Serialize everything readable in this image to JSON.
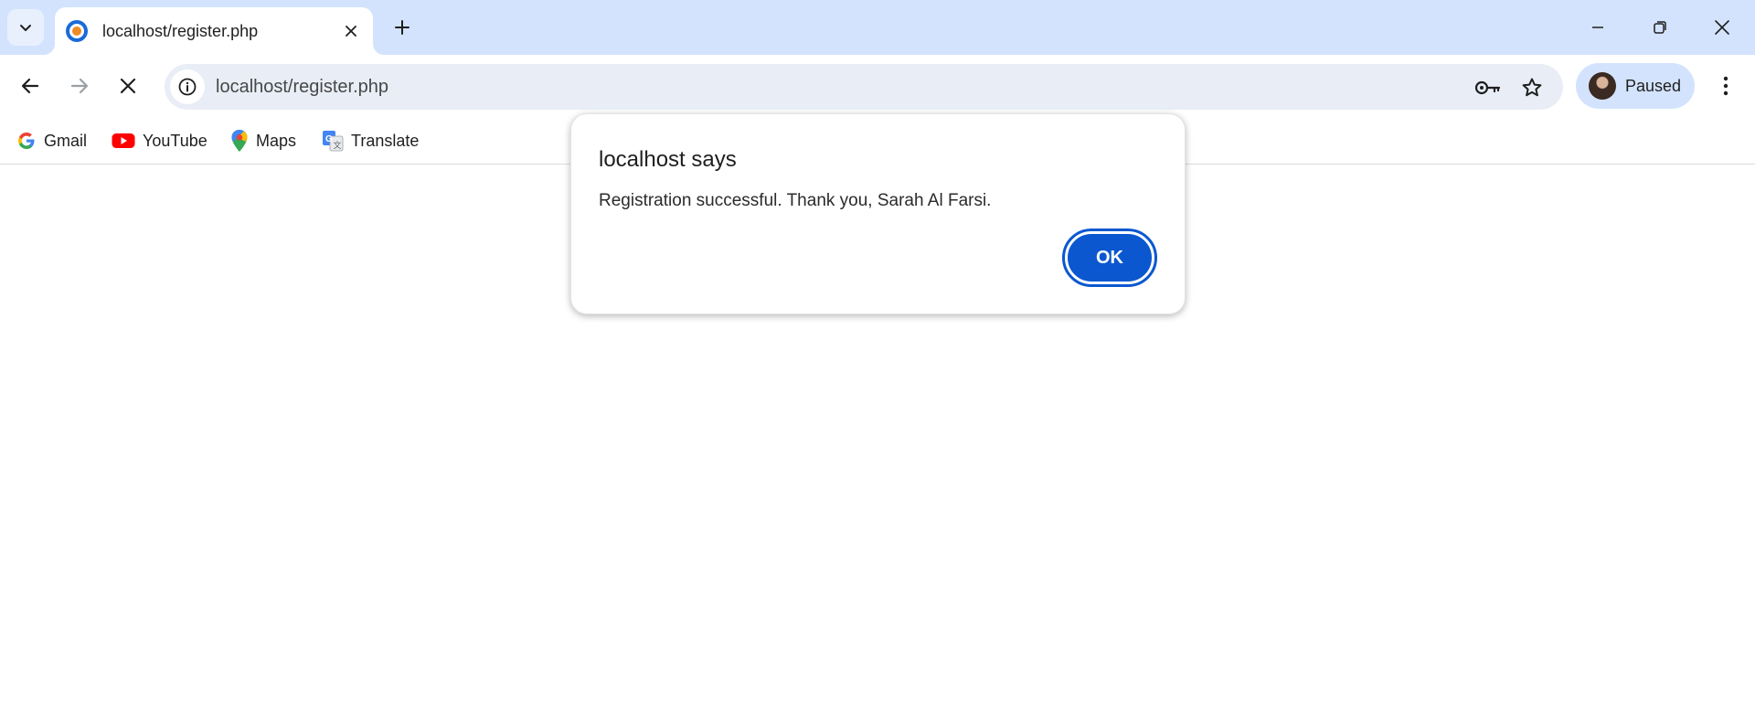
{
  "tab": {
    "title": "localhost/register.php"
  },
  "omnibox": {
    "url": "localhost/register.php"
  },
  "profile": {
    "label": "Paused"
  },
  "bookmarks": [
    {
      "label": "Gmail",
      "icon": "google-icon"
    },
    {
      "label": "YouTube",
      "icon": "youtube-icon"
    },
    {
      "label": "Maps",
      "icon": "maps-icon"
    },
    {
      "label": "Translate",
      "icon": "translate-icon"
    }
  ],
  "dialog": {
    "title": "localhost says",
    "message": "Registration successful. Thank you, Sarah Al Farsi.",
    "ok_label": "OK"
  },
  "colors": {
    "tabstrip": "#d3e3fd",
    "omnibox": "#e9eef6",
    "accent": "#0b57d0"
  }
}
